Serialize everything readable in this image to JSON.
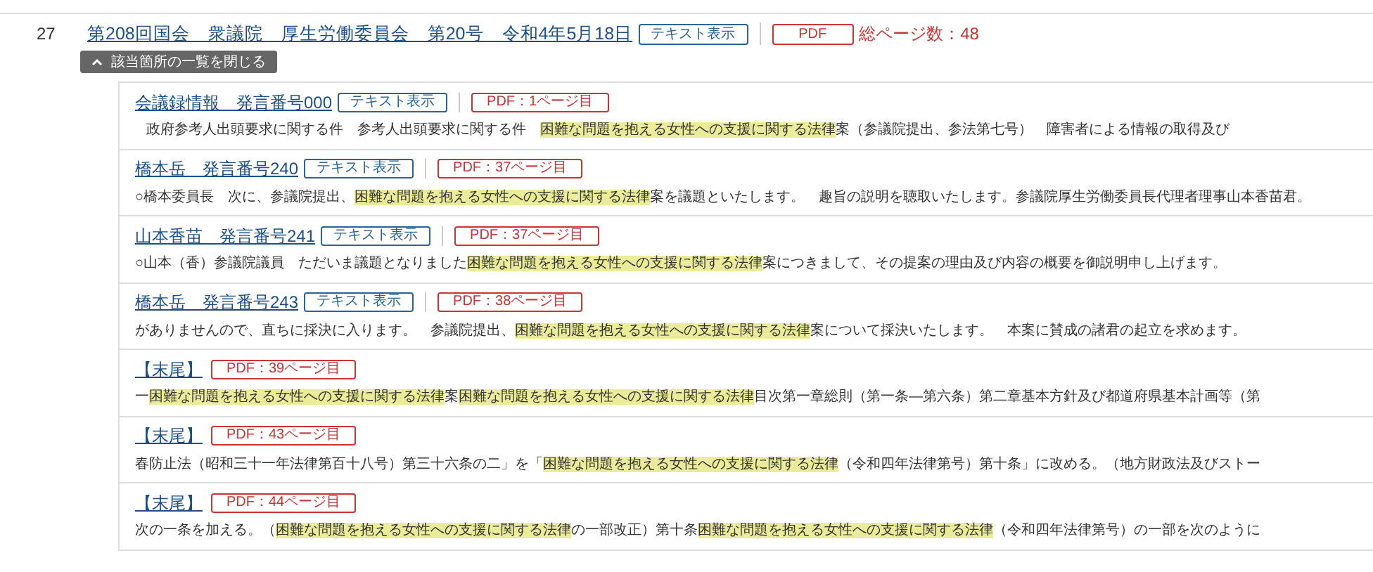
{
  "record": {
    "number": "27",
    "title": "第208回国会　衆議院　厚生労働委員会　第20号　令和4年5月18日",
    "text_button": "テキスト表示",
    "pdf_button": "PDF",
    "page_count": "総ページ数：48",
    "collapse_button": "該当箇所の一覧を閉じる",
    "expanded": true
  },
  "hits": [
    {
      "speaker": "会議録情報　発言番号000",
      "text_button": "テキスト表示",
      "pdf_button": "PDF：1ページ目",
      "snippet": [
        {
          "text": "政府参考人出頭要求に関する件　参考人出頭要求に関する件　",
          "highlighted": false
        },
        {
          "text": "困難な問題を抱える女性への支援に関する法律",
          "highlighted": true
        },
        {
          "text": "案（参議院提出、参法第七号）　障害者による情報の取得及び",
          "highlighted": false
        }
      ]
    },
    {
      "speaker": "橋本岳　発言番号240",
      "text_button": "テキスト表示",
      "pdf_button": "PDF：37ページ目",
      "snippet": [
        {
          "text": "○橋本委員長　次に、参議院提出、",
          "highlighted": false
        },
        {
          "text": "困難な問題を抱える女性への支援に関する法律",
          "highlighted": true
        },
        {
          "text": "案を議題といたします。　趣旨の説明を聴取いたします。参議院厚生労働委員長代理者理事山本香苗君。",
          "highlighted": false
        }
      ]
    },
    {
      "speaker": "山本香苗　発言番号241",
      "text_button": "テキスト表示",
      "pdf_button": "PDF：37ページ目",
      "snippet": [
        {
          "text": "○山本（香）参議院議員　ただいま議題となりました",
          "highlighted": false
        },
        {
          "text": "困難な問題を抱える女性への支援に関する法律",
          "highlighted": true
        },
        {
          "text": "案につきまして、その提案の理由及び内容の概要を御説明申し上げます。",
          "highlighted": false
        }
      ]
    },
    {
      "speaker": "橋本岳　発言番号243",
      "text_button": "テキスト表示",
      "pdf_button": "PDF：38ページ目",
      "snippet": [
        {
          "text": "がありませんので、直ちに採決に入ります。　参議院提出、",
          "highlighted": false
        },
        {
          "text": "困難な問題を抱える女性への支援に関する法律",
          "highlighted": true
        },
        {
          "text": "案について採決いたします。　本案に賛成の諸君の起立を求めます。",
          "highlighted": false
        }
      ]
    },
    {
      "speaker": "【末尾】",
      "pdf_button": "PDF：39ページ目",
      "snippet": [
        {
          "text": "一",
          "highlighted": false
        },
        {
          "text": "困難な問題を抱える女性への支援に関する法律",
          "highlighted": true
        },
        {
          "text": "案",
          "highlighted": false
        },
        {
          "text": "困難な問題を抱える女性への支援に関する法律",
          "highlighted": true
        },
        {
          "text": "目次第一章総則（第一条―第六条）第二章基本方針及び都道府県基本計画等（第",
          "highlighted": false
        }
      ]
    },
    {
      "speaker": "【末尾】",
      "pdf_button": "PDF：43ページ目",
      "snippet": [
        {
          "text": "春防止法（昭和三十一年法律第百十八号）第三十六条の二」を「",
          "highlighted": false
        },
        {
          "text": "困難な問題を抱える女性への支援に関する法律",
          "highlighted": true
        },
        {
          "text": "（令和四年法律第号）第十条」に改める。（地方財政法及びストー",
          "highlighted": false
        }
      ]
    },
    {
      "speaker": "【末尾】",
      "pdf_button": "PDF：44ページ目",
      "snippet": [
        {
          "text": "次の一条を加える。（",
          "highlighted": false
        },
        {
          "text": "困難な問題を抱える女性への支援に関する法律",
          "highlighted": true
        },
        {
          "text": "の一部改正）第十条",
          "highlighted": false
        },
        {
          "text": "困難な問題を抱える女性への支援に関する法律",
          "highlighted": true
        },
        {
          "text": "（令和四年法律第号）の一部を次のように",
          "highlighted": false
        }
      ]
    }
  ]
}
